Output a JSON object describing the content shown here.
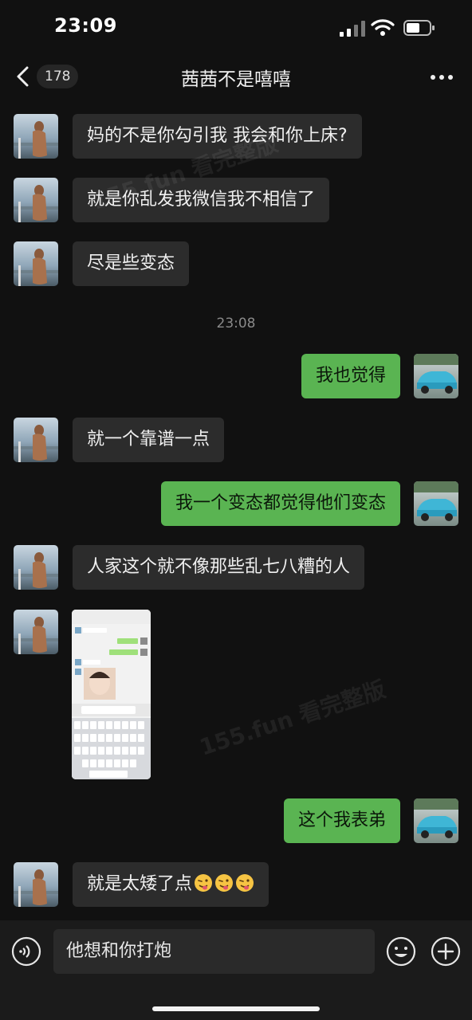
{
  "status_bar": {
    "time": "23:09",
    "signal_icon": "cellular-signal-icon",
    "wifi_icon": "wifi-icon",
    "battery_icon": "battery-icon"
  },
  "nav": {
    "back_icon": "chevron-left-icon",
    "unread_count": "178",
    "title": "茜茜不是嘻嘻",
    "more_icon": "ellipsis-icon"
  },
  "messages": [
    {
      "side": "in",
      "text": "妈的不是你勾引我 我会和你上床?"
    },
    {
      "side": "in",
      "text": "就是你乱发我微信我不相信了"
    },
    {
      "side": "in",
      "text": "尽是些变态"
    },
    {
      "timestamp": "23:08"
    },
    {
      "side": "out",
      "text": "我也觉得"
    },
    {
      "side": "in",
      "text": "就一个靠谱一点"
    },
    {
      "side": "out",
      "text": "我一个变态都觉得他们变态"
    },
    {
      "side": "in",
      "text": "人家这个就不像那些乱七八糟的人"
    },
    {
      "side": "in",
      "image": "screenshot-thumbnail"
    },
    {
      "side": "out",
      "text": "这个我表弟"
    },
    {
      "side": "in",
      "text": "就是太矮了点",
      "emojis": [
        "tongue-wink-emoji",
        "tongue-wink-emoji",
        "tongue-wink-emoji"
      ]
    }
  ],
  "watermark": "155.fun 看完整版",
  "input_bar": {
    "voice_icon": "voice-icon",
    "draft_text": "他想和你打炮",
    "emoji_icon": "smiley-icon",
    "plus_icon": "plus-circle-icon"
  },
  "colors": {
    "background": "#111111",
    "incoming_bubble": "#2c2c2c",
    "outgoing_bubble": "#5ab452",
    "timestamp": "#8a8a8a"
  }
}
